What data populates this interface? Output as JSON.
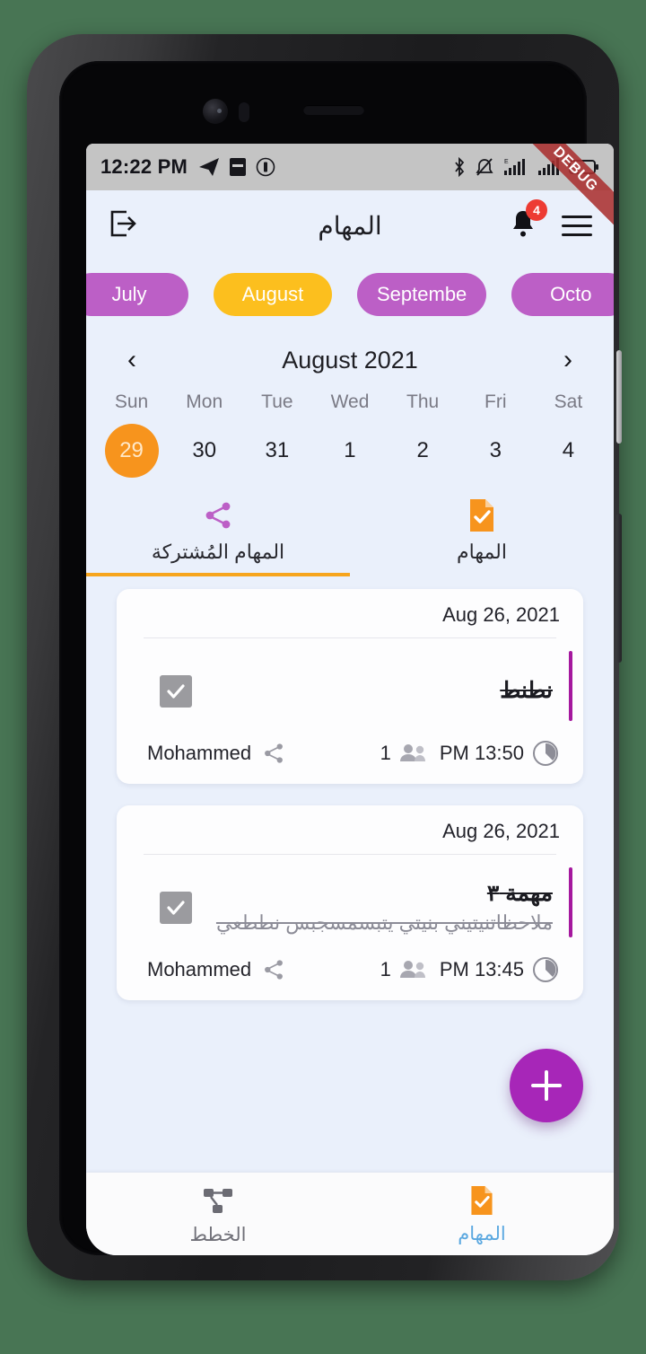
{
  "status_bar": {
    "time": "12:22 PM",
    "left_icons": [
      "telegram-icon",
      "app-notification-icon",
      "vibrate-icon"
    ],
    "right_icons": [
      "bluetooth-icon",
      "mute-icon",
      "signal-edge-icon",
      "signal-icon",
      "battery-icon"
    ],
    "background": "#C4C4C4"
  },
  "debug_ribbon": {
    "label": "DEBUG",
    "color": "#AA3030"
  },
  "app_bar": {
    "title": "المهام",
    "logout_icon": "exit-icon",
    "bell_badge": "4",
    "menu_icon": "hamburger-icon"
  },
  "month_chips": {
    "items": [
      {
        "label": "July",
        "selected": false
      },
      {
        "label": "August",
        "selected": true
      },
      {
        "label": "Septembe",
        "selected": false
      },
      {
        "label": "Octo",
        "selected": false
      }
    ],
    "default_color": "#BC5FC6",
    "selected_color": "#FCBF1E"
  },
  "calendar": {
    "month_label": "August 2021",
    "prev_label": "‹",
    "next_label": "›",
    "weekdays": [
      "Sun",
      "Mon",
      "Tue",
      "Wed",
      "Thu",
      "Fri",
      "Sat"
    ],
    "dates": [
      {
        "day": "29",
        "selected": true
      },
      {
        "day": "30",
        "selected": false
      },
      {
        "day": "31",
        "selected": false
      },
      {
        "day": "1",
        "selected": false
      },
      {
        "day": "2",
        "selected": false
      },
      {
        "day": "3",
        "selected": false
      },
      {
        "day": "4",
        "selected": false
      }
    ],
    "selected_color": "#F7941D"
  },
  "tabs": [
    {
      "label": "المهام المُشتركة",
      "icon": "share-icon",
      "active": true
    },
    {
      "label": "المهام",
      "icon": "task-document-icon",
      "active": false
    }
  ],
  "tasks": [
    {
      "date": "Aug 26, 2021",
      "title": "نطنط",
      "description": "",
      "owner": "Mohammed",
      "shared_count": "1",
      "time": "PM 13:50",
      "completed": true,
      "accent_color": "#A5189E"
    },
    {
      "date": "Aug 26, 2021",
      "title": "مهمة ٣",
      "description": "ملاحظاتنيتيني بنيتي يتبسمسجبس نططعي",
      "owner": "Mohammed",
      "shared_count": "1",
      "time": "PM 13:45",
      "completed": true,
      "accent_color": "#A5189E"
    }
  ],
  "fab": {
    "label": "+",
    "color": "#A726B8",
    "name": "add-task"
  },
  "bottom_nav": [
    {
      "label": "الخطط",
      "icon": "plans-hierarchy-icon",
      "active": false
    },
    {
      "label": "المهام",
      "icon": "task-document-icon",
      "active": true
    }
  ]
}
